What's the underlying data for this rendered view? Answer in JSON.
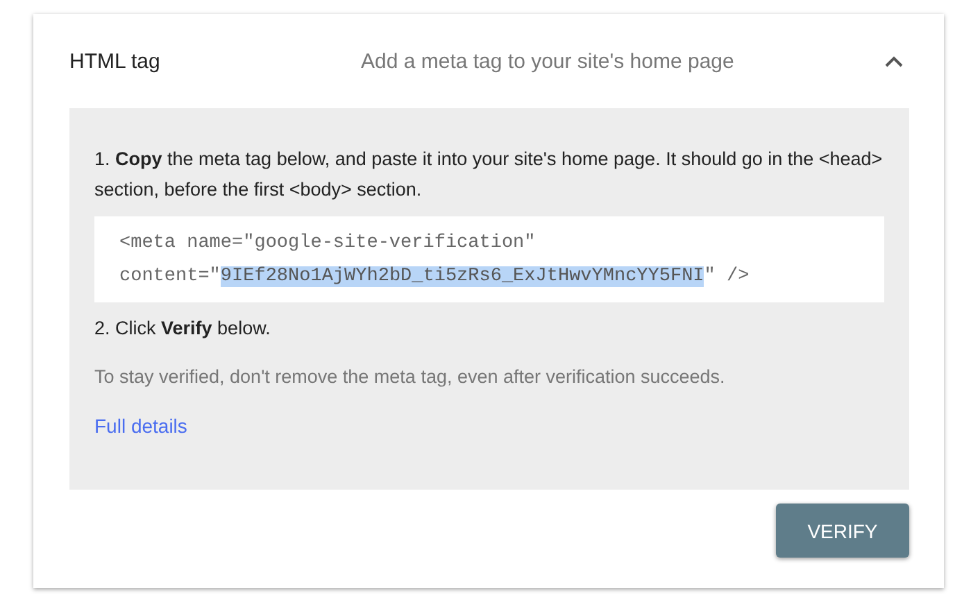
{
  "section": {
    "title": "HTML tag",
    "subtitle": "Add a meta tag to your site's home page",
    "expanded": true
  },
  "steps": [
    {
      "kind": "text",
      "text": "1. **Copy** the meta tag below, and paste it into your site's home page. It should go in the <head> section, before the first <body> section."
    },
    {
      "kind": "code",
      "line_1": "<meta name=\"google-site-verification\"",
      "before": "content=\"",
      "highlighted": "9IEf28No1AjWYh2bD_ti5zRs6_ExJtHwvYMncYY5FNI",
      "after": "\" />"
    },
    {
      "kind": "text",
      "text": "2. Click **Verify** below."
    }
  ],
  "note": "To stay verified, don't remove the meta tag, even after verification succeeds.",
  "link": "Full details",
  "button": "VERIFY"
}
